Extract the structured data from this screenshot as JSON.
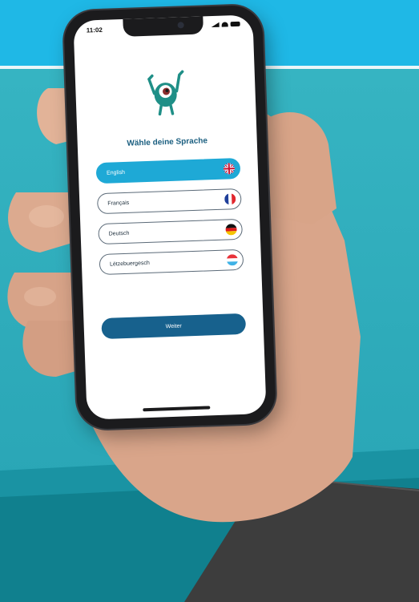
{
  "status_bar": {
    "time": "11:02"
  },
  "screen": {
    "title": "Wähle deine Sprache",
    "languages": [
      {
        "label": "English",
        "selected": true,
        "flag": "uk-flag-icon"
      },
      {
        "label": "Français",
        "selected": false,
        "flag": "france-flag-icon"
      },
      {
        "label": "Deutsch",
        "selected": false,
        "flag": "germany-flag-icon"
      },
      {
        "label": "Lëtzebuergesch",
        "selected": false,
        "flag": "luxembourg-flag-icon"
      }
    ],
    "next_label": "Weiter"
  },
  "colors": {
    "accent": "#1ea9d6",
    "primary_button": "#17618d",
    "title": "#1b5f80",
    "background_top": "#1fb8e6",
    "background_main": "#2fb1c1"
  }
}
